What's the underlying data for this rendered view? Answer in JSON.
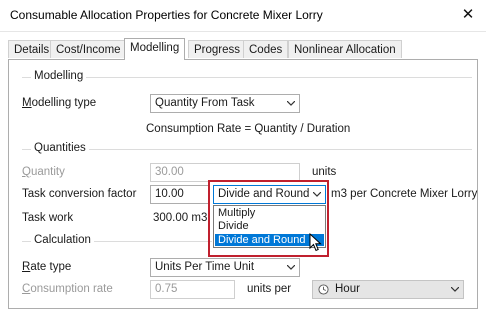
{
  "window": {
    "title": "Consumable Allocation Properties for Concrete Mixer Lorry",
    "close_glyph": "✕"
  },
  "tabs": [
    {
      "label": "Details"
    },
    {
      "label": "Cost/Income"
    },
    {
      "label": "Modelling",
      "active": true
    },
    {
      "label": "Progress"
    },
    {
      "label": "Codes"
    },
    {
      "label": "Nonlinear Allocation"
    }
  ],
  "modelling": {
    "section": "Modelling",
    "type_label_prefix": "",
    "type_label_u": "M",
    "type_label_rest": "odelling type",
    "type_value": "Quantity From Task",
    "formula": "Consumption Rate = Quantity / Duration"
  },
  "quantities": {
    "section": "Quantities",
    "quantity_label_u": "Q",
    "quantity_label_rest": "uantity",
    "quantity_value": "30.00",
    "quantity_units": "units",
    "factor_label": "Task conversion factor",
    "factor_value": "10.00",
    "factor_mode": "Divide and Round",
    "factor_units": "m3 per Concrete Mixer Lorry",
    "work_label": "Task work",
    "work_value": "300.00 m3"
  },
  "dropdown_options": [
    {
      "label": "Multiply"
    },
    {
      "label": "Divide"
    },
    {
      "label": "Divide and Round",
      "selected": true
    }
  ],
  "calculation": {
    "section": "Calculation",
    "rate_label_u": "R",
    "rate_label_rest": "ate type",
    "rate_value": "Units Per Time Unit",
    "consumption_label_u": "C",
    "consumption_label_rest": "onsumption rate",
    "consumption_value": "0.75",
    "units_per": "units per",
    "time_unit": "Hour"
  },
  "colors": {
    "accent": "#0078d7",
    "highlight_outline": "#c0202e"
  },
  "icons": {
    "clock": "clock-icon",
    "close": "close-icon",
    "chevron": "chevron-down-icon",
    "cursor": "mouse-cursor-icon"
  }
}
